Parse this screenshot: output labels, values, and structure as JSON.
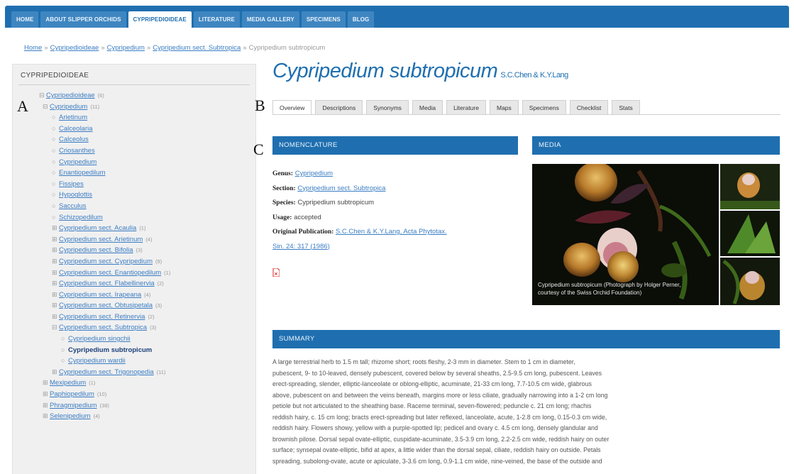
{
  "nav": {
    "tabs": [
      {
        "label": "HOME"
      },
      {
        "label": "ABOUT SLIPPER ORCHIDS"
      },
      {
        "label": "CYPRIPEDIOIDEAE"
      },
      {
        "label": "LITERATURE"
      },
      {
        "label": "MEDIA GALLERY"
      },
      {
        "label": "SPECIMENS"
      },
      {
        "label": "BLOG"
      }
    ],
    "active": "CYPRIPEDIOIDEAE"
  },
  "breadcrumb": {
    "items": [
      "Home",
      "Cypripedioideae",
      "Cypripedium",
      "Cypripedium sect. Subtropica"
    ],
    "separator": "»",
    "current": "Cypripedium subtropicum"
  },
  "sidebar": {
    "title": "CYPRIPEDIOIDEAE",
    "items": [
      {
        "label": "Cypripedioideae",
        "count": "(6)",
        "marker": "⊟"
      },
      {
        "label": "Cypripedium",
        "count": "(11)",
        "marker": "⊟"
      },
      {
        "label": "Arietinum",
        "marker": "○"
      },
      {
        "label": "Calceolaria",
        "marker": "○"
      },
      {
        "label": "Calceolus",
        "marker": "○"
      },
      {
        "label": "Criosanthes",
        "marker": "○"
      },
      {
        "label": "Cypripedium",
        "marker": "○"
      },
      {
        "label": "Enantiopedilum",
        "marker": "○"
      },
      {
        "label": "Fissipes",
        "marker": "○"
      },
      {
        "label": "Hypoglottis",
        "marker": "○"
      },
      {
        "label": "Sacculus",
        "marker": "○"
      },
      {
        "label": "Schizopedilum",
        "marker": "○"
      },
      {
        "label": "Cypripedium sect. Acaulia",
        "count": "(1)",
        "marker": "⊞"
      },
      {
        "label": "Cypripedium sect. Arietinum",
        "count": "(4)",
        "marker": "⊞"
      },
      {
        "label": "Cypripedium sect. Bifolia",
        "count": "(3)",
        "marker": "⊞"
      },
      {
        "label": "Cypripedium sect. Cypripedium",
        "count": "(9)",
        "marker": "⊞"
      },
      {
        "label": "Cypripedium sect. Enantiopedilum",
        "count": "(1)",
        "marker": "⊞"
      },
      {
        "label": "Cypripedium sect. Flabellinervia",
        "count": "(2)",
        "marker": "⊞"
      },
      {
        "label": "Cypripedium sect. Irapeana",
        "count": "(4)",
        "marker": "⊞"
      },
      {
        "label": "Cypripedium sect. Obtusipetala",
        "count": "(3)",
        "marker": "⊞"
      },
      {
        "label": "Cypripedium sect. Retinervia",
        "count": "(2)",
        "marker": "⊞"
      },
      {
        "label": "Cypripedium sect. Subtropica",
        "count": "(3)",
        "marker": "⊟"
      },
      {
        "label": "Cypripedium singchii",
        "marker": "○"
      },
      {
        "label": "Cypripedium subtropicum",
        "marker": "○"
      },
      {
        "label": "Cypripedium wardii",
        "marker": "○"
      },
      {
        "label": "Cypripedium sect. Trigonopedia",
        "count": "(11)",
        "marker": "⊞"
      },
      {
        "label": "Mexipedium",
        "count": "(1)",
        "marker": "⊞"
      },
      {
        "label": "Paphiopedilum",
        "count": "(10)",
        "marker": "⊞"
      },
      {
        "label": "Phragmipedium",
        "count": "(38)",
        "marker": "⊞"
      },
      {
        "label": "Selenipedium",
        "count": "(4)",
        "marker": "⊞"
      }
    ]
  },
  "annotations": {
    "a": "A",
    "b": "B",
    "c": "C"
  },
  "species": {
    "name": "Cypripedium subtropicum",
    "author": "S.C.Chen & K.Y.Lang"
  },
  "tabs": [
    "Overview",
    "Descriptions",
    "Synonyms",
    "Media",
    "Literature",
    "Maps",
    "Specimens",
    "Checklist",
    "Stats"
  ],
  "nomenclature": {
    "heading": "NOMENCLATURE",
    "genus_label": "Genus:",
    "genus_value": "Cypripedium",
    "section_label": "Section:",
    "section_value": "Cypripedium sect. Subtropica",
    "species_label": "Species:",
    "species_value": "Cypripedium subtropicum",
    "usage_label": "Usage:",
    "usage_value": "accepted",
    "pub_label": "Original Publication:",
    "pub_line1": "S.C.Chen & K.Y.Lang, Acta Phytotax.",
    "pub_line2": "Sin. 24: 317 (1986)"
  },
  "media": {
    "heading": "MEDIA",
    "caption": "Cypripedium subtropicum (Photograph by Holger Perner, courtesy of the Swiss Orchid Foundation)"
  },
  "summary": {
    "heading": "SUMMARY",
    "lines": [
      "A large terrestrial herb to 1.5 m tall; rhizome short; roots fleshy, 2-3 mm in diameter. Stem to 1 cm in diameter,",
      "pubescent, 9- to 10-leaved, densely pubescent, covered below by several sheaths, 2.5-9.5 cm long, pubescent. Leaves",
      "erect-spreading, slender, elliptic-lanceolate or oblong-elliptic, acuminate, 21-33 cm long, 7.7-10.5 cm wide, glabrous",
      "above, pubescent on and between the veins beneath, margins more or less ciliate, gradually narrowing into a 1-2 cm long",
      "petiole but not articulated to the sheathing base. Raceme terminal, seven-flowered; peduncle c. 21 cm long; rhachis",
      "reddish hairy, c. 15 cm long; bracts erect-spreading but later reflexed, lanceolate, acute, 1-2.8 cm long, 0.15-0.3 cm wide,",
      "reddish hairy. Flowers showy, yellow with a purple-spotted lip; pedicel and ovary c. 4.5 cm long, densely glandular and",
      "brownish pilose. Dorsal sepal ovate-elliptic, cuspidate-acuminate, 3.5-3.9 cm long, 2.2-2.5 cm wide, reddish hairy on outer",
      "surface; synsepal ovate-elliptic, bifid at apex, a little wider than the dorsal sepal, ciliate, reddish hairy on outside. Petals",
      "spreading, subolong-ovate, acute or apiculate, 3-3.6 cm long, 0.9-1.1 cm wide, nine-veined, the base of the outside and"
    ]
  },
  "colors": {
    "brand_blue": "#1f6fb0",
    "link": "#3b7dc4",
    "sidebar_bg": "#f0f0f0"
  }
}
